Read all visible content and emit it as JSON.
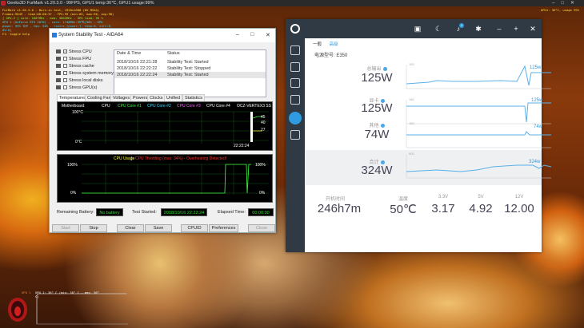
{
  "taskbar": {
    "title": "Geeks3D FurMark v1.20.3.0 - 99FPS, GPU1 temp:36℃, GPU1 usage:99%"
  },
  "osd": {
    "lines": [
      "FurMark v1.20.3.0 - Burn-in test, 1920x1080 (8X MSAA)",
      "Frames:9849 - time:00:00:37 - FPS:99 (min:85, max:96, avg:98)",
      "[ GPU-Z ] core: 1607MHz - mem: 3802MHz - GPU load: 99 %",
      "GPU 1 (GeForce RTX 2070) - core: 1740MHz:99℃/50% - GPU power: 99% TDP - fan: 50% - limits:[power:1, temp:0, volt:0, OV:0]",
      "F1: toggle help"
    ]
  },
  "osd_right": "GPU1: 36°C, usage 99%",
  "mini": {
    "label": "GPU 1: 36° C (min: 36° C - max: 36° C)",
    "gpu": "GPU 1"
  },
  "aida": {
    "title": "System Stability Test - AIDA64",
    "controls": [
      "–",
      "□",
      "✕"
    ],
    "checks": [
      {
        "label": "Stress CPU",
        "checked": true,
        "icon": "cpu-icon"
      },
      {
        "label": "Stress FPU",
        "checked": false,
        "icon": "fpu-icon"
      },
      {
        "label": "Stress cache",
        "checked": false,
        "icon": "cache-icon"
      },
      {
        "label": "Stress system memory",
        "checked": false,
        "icon": "memory-icon"
      },
      {
        "label": "Stress local disks",
        "checked": false,
        "icon": "disk-icon"
      },
      {
        "label": "Stress GPU(s)",
        "checked": false,
        "icon": "gpu-icon"
      }
    ],
    "log_headers": [
      "Date & Time",
      "Status"
    ],
    "log": [
      {
        "time": "2018/10/16 22:21:28",
        "status": "Stability Test: Started"
      },
      {
        "time": "2018/10/16 22:22:22",
        "status": "Stability Test: Stopped"
      },
      {
        "time": "2018/10/16 22:22:24",
        "status": "Stability Test: Started"
      }
    ],
    "tabs": [
      "Temperatures",
      "Cooling Fans",
      "Voltages",
      "Powers",
      "Clocks",
      "Unified",
      "Statistics"
    ],
    "temp_legend": [
      "Motherboard",
      "CPU",
      "CPU Core #1",
      "CPU Core #2",
      "CPU Core #3",
      "CPU Core #4",
      "OCZ-VERTEX3 SS"
    ],
    "temp_top": "100°C",
    "temp_bottom": "0°C",
    "temp_time": "22:22:24",
    "temp_vals": [
      "27",
      "40",
      "45"
    ],
    "usage_title": "CPU Usage",
    "usage_sep": "|",
    "usage_thr": "CPU Throttling (max: 34%) - Overheating Detected!",
    "usage_top": "100%",
    "usage_bottom": "0%",
    "usage_r_top": "100%",
    "usage_r_bottom": "0%",
    "battery_label": "Remaining Battery:",
    "battery": "No battery",
    "started_label": "Test Started:",
    "started": "2018/10/16 22:22:24",
    "elapsed_label": "Elapsed Time:",
    "elapsed": "00:00:00",
    "buttons": [
      "Start",
      "Stop",
      "Clear",
      "Save",
      "CPUID",
      "Preferences",
      "Close"
    ]
  },
  "monitor": {
    "tabs": [
      "一般",
      "高级"
    ],
    "device": "电源型号: E350",
    "rows": [
      {
        "label": "总输出",
        "value": "125W",
        "chart_label": "125w",
        "ymax": "150"
      },
      {
        "label": "显卡",
        "value": "125W",
        "chart_label": "125w",
        "ymax": "150"
      },
      {
        "label": "其他",
        "value": "74W",
        "chart_label": "74w",
        "ymax": "150"
      },
      {
        "label": "合计",
        "value": "324W",
        "chart_label": "324w",
        "ymax": "600"
      }
    ],
    "bottom": [
      {
        "label": "开机时间",
        "value": "246h7m"
      },
      {
        "label": "温度",
        "value": "50℃"
      },
      {
        "label": "3.3V",
        "value": "3.17"
      },
      {
        "label": "5V",
        "value": "4.92"
      },
      {
        "label": "12V",
        "value": "12.00"
      }
    ],
    "badge": "1",
    "accent": "#2f9be0"
  }
}
